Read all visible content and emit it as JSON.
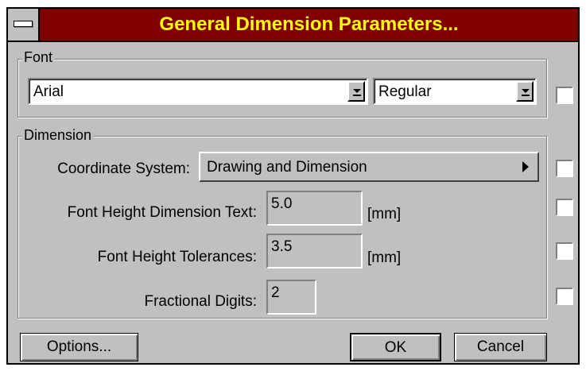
{
  "dialog": {
    "title": "General Dimension Parameters..."
  },
  "font_group": {
    "label": "Font",
    "font_name": "Arial",
    "font_style": "Regular"
  },
  "dimension_group": {
    "label": "Dimension",
    "coordinate_system_label": "Coordinate System:",
    "coordinate_system_value": "Drawing and Dimension",
    "font_height_text_label": "Font Height Dimension Text:",
    "font_height_text_value": "5.0",
    "font_height_text_unit": "[mm]",
    "font_height_tol_label": "Font Height Tolerances:",
    "font_height_tol_value": "3.5",
    "font_height_tol_unit": "[mm]",
    "fractional_digits_label": "Fractional Digits:",
    "fractional_digits_value": "2"
  },
  "buttons": {
    "options_label": "Options...",
    "ok_label": "OK",
    "cancel_label": "Cancel"
  }
}
